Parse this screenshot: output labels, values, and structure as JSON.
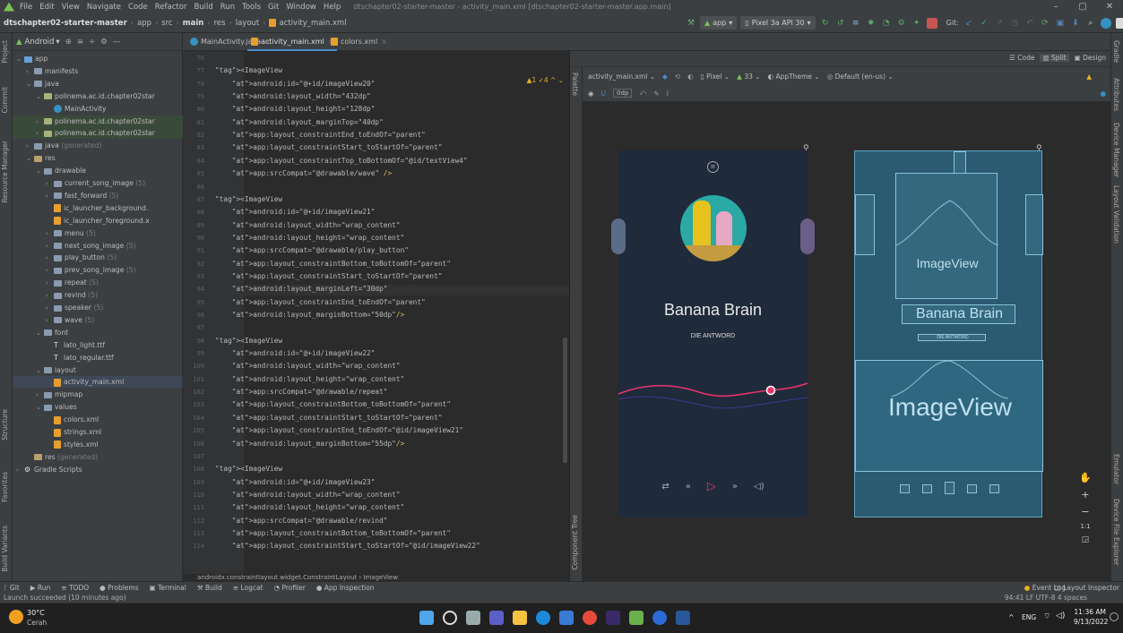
{
  "menubar": {
    "items": [
      "File",
      "Edit",
      "View",
      "Navigate",
      "Code",
      "Refactor",
      "Build",
      "Run",
      "Tools",
      "Git",
      "Window",
      "Help"
    ],
    "window_title": "dtschapter02-starter-master - activity_main.xml [dtschapter02-starter-master.app.main]",
    "controls": [
      "–",
      "▢",
      "✕"
    ]
  },
  "navbar": {
    "breadcrumbs": [
      "dtschapter02-starter-master",
      "app",
      "src",
      "main",
      "res",
      "layout",
      "activity_main.xml"
    ],
    "run_config": "app",
    "device": "Pixel 3a API 30",
    "git_label": "Git:"
  },
  "project_panel": {
    "view_label": "Android",
    "tree": [
      {
        "label": "app",
        "indent": 0,
        "kind": "module",
        "arrow": "⌄"
      },
      {
        "label": "manifests",
        "indent": 1,
        "kind": "folder",
        "arrow": "›"
      },
      {
        "label": "java",
        "indent": 1,
        "kind": "folder",
        "arrow": "⌄"
      },
      {
        "label": "polinema.ac.id.chapter02star",
        "indent": 2,
        "kind": "pkg",
        "arrow": "⌄"
      },
      {
        "label": "MainActivity",
        "indent": 3,
        "kind": "class",
        "arrow": ""
      },
      {
        "label": "polinema.ac.id.chapter02star",
        "indent": 2,
        "kind": "pkg",
        "arrow": "›",
        "extra": "sel2"
      },
      {
        "label": "polinema.ac.id.chapter02star",
        "indent": 2,
        "kind": "pkg",
        "arrow": "›",
        "extra": "sel2"
      },
      {
        "label": "java",
        "indent": 1,
        "kind": "folder",
        "arrow": "›",
        "suffix": " (generated)"
      },
      {
        "label": "res",
        "indent": 1,
        "kind": "res",
        "arrow": "⌄"
      },
      {
        "label": "drawable",
        "indent": 2,
        "kind": "folder",
        "arrow": "⌄"
      },
      {
        "label": "current_song_image",
        "indent": 3,
        "kind": "folder",
        "arrow": "›",
        "suffix": " (5)"
      },
      {
        "label": "fast_forward",
        "indent": 3,
        "kind": "folder",
        "arrow": "›",
        "suffix": " (5)"
      },
      {
        "label": "ic_launcher_background.",
        "indent": 3,
        "kind": "xml",
        "arrow": ""
      },
      {
        "label": "ic_launcher_foreground.x",
        "indent": 3,
        "kind": "xml",
        "arrow": ""
      },
      {
        "label": "menu",
        "indent": 3,
        "kind": "folder",
        "arrow": "›",
        "suffix": " (5)"
      },
      {
        "label": "next_song_image",
        "indent": 3,
        "kind": "folder",
        "arrow": "›",
        "suffix": " (5)"
      },
      {
        "label": "play_button",
        "indent": 3,
        "kind": "folder",
        "arrow": "›",
        "suffix": " (5)"
      },
      {
        "label": "prev_song_image",
        "indent": 3,
        "kind": "folder",
        "arrow": "›",
        "suffix": " (5)"
      },
      {
        "label": "repeat",
        "indent": 3,
        "kind": "folder",
        "arrow": "›",
        "suffix": " (5)"
      },
      {
        "label": "revind",
        "indent": 3,
        "kind": "folder",
        "arrow": "›",
        "suffix": " (5)"
      },
      {
        "label": "speaker",
        "indent": 3,
        "kind": "folder",
        "arrow": "›",
        "suffix": " (5)"
      },
      {
        "label": "wave",
        "indent": 3,
        "kind": "folder",
        "arrow": "›",
        "suffix": " (5)"
      },
      {
        "label": "font",
        "indent": 2,
        "kind": "folder",
        "arrow": "⌄"
      },
      {
        "label": "lato_light.ttf",
        "indent": 3,
        "kind": "ttf",
        "arrow": ""
      },
      {
        "label": "lato_regular.ttf",
        "indent": 3,
        "kind": "ttf",
        "arrow": ""
      },
      {
        "label": "layout",
        "indent": 2,
        "kind": "folder",
        "arrow": "⌄"
      },
      {
        "label": "activity_main.xml",
        "indent": 3,
        "kind": "xml",
        "arrow": ""
      },
      {
        "label": "mipmap",
        "indent": 2,
        "kind": "folder",
        "arrow": "›"
      },
      {
        "label": "values",
        "indent": 2,
        "kind": "folder",
        "arrow": "⌄"
      },
      {
        "label": "colors.xml",
        "indent": 3,
        "kind": "xml",
        "arrow": ""
      },
      {
        "label": "strings.xml",
        "indent": 3,
        "kind": "xml",
        "arrow": ""
      },
      {
        "label": "styles.xml",
        "indent": 3,
        "kind": "xml",
        "arrow": ""
      },
      {
        "label": "res",
        "indent": 1,
        "kind": "res",
        "arrow": "",
        "suffix": " (generated)"
      },
      {
        "label": "Gradle Scripts",
        "indent": 0,
        "kind": "gradle",
        "arrow": "›"
      }
    ]
  },
  "left_strip_labels": [
    "Project",
    "Commit",
    "Resource Manager",
    "Structure",
    "Favorites",
    "Build Variants"
  ],
  "right_strip_labels": [
    "Gradle",
    "Attributes",
    "Device Manager",
    "Layout Validation",
    "Emulator",
    "Device File Explorer"
  ],
  "tabs": [
    {
      "label": "MainActivity.java",
      "active": false
    },
    {
      "label": "activity_main.xml",
      "active": true
    },
    {
      "label": "colors.xml",
      "active": false
    }
  ],
  "editor": {
    "warning_indicator": "▲1 ✓4 ^ ⌄",
    "lines": [
      {
        "n": "76",
        "t": ""
      },
      {
        "n": "77",
        "t": "<ImageView"
      },
      {
        "n": "78",
        "t": "    android:id=\"@+id/imageView20\""
      },
      {
        "n": "79",
        "t": "    android:layout_width=\"432dp\""
      },
      {
        "n": "80",
        "t": "    android:layout_height=\"128dp\""
      },
      {
        "n": "81",
        "t": "    android:layout_marginTop=\"40dp\""
      },
      {
        "n": "82",
        "t": "    app:layout_constraintEnd_toEndOf=\"parent\""
      },
      {
        "n": "83",
        "t": "    app:layout_constraintStart_toStartOf=\"parent\""
      },
      {
        "n": "84",
        "t": "    app:layout_constraintTop_toBottomOf=\"@id/textView4\""
      },
      {
        "n": "85",
        "t": "    app:srcCompat=\"@drawable/wave\" />"
      },
      {
        "n": "86",
        "t": ""
      },
      {
        "n": "87",
        "t": "<ImageView"
      },
      {
        "n": "88",
        "t": "    android:id=\"@+id/imageView21\""
      },
      {
        "n": "89",
        "t": "    android:layout_width=\"wrap_content\""
      },
      {
        "n": "90",
        "t": "    android:layout_height=\"wrap_content\""
      },
      {
        "n": "91",
        "t": "    app:srcCompat=\"@drawable/play_button\""
      },
      {
        "n": "92",
        "t": "    app:layout_constraintBottom_toBottomOf=\"parent\""
      },
      {
        "n": "93",
        "t": "    app:layout_constraintStart_toStartOf=\"parent\""
      },
      {
        "n": "94",
        "t": "    android:layout_marginLeft=\"30dp\""
      },
      {
        "n": "95",
        "t": "    app:layout_constraintEnd_toEndOf=\"parent\""
      },
      {
        "n": "96",
        "t": "    android:layout_marginBottom=\"50dp\"/>"
      },
      {
        "n": "97",
        "t": ""
      },
      {
        "n": "98",
        "t": "<ImageView"
      },
      {
        "n": "99",
        "t": "    android:id=\"@+id/imageView22\""
      },
      {
        "n": "100",
        "t": "    android:layout_width=\"wrap_content\""
      },
      {
        "n": "101",
        "t": "    android:layout_height=\"wrap_content\""
      },
      {
        "n": "102",
        "t": "    app:srcCompat=\"@drawable/repeat\""
      },
      {
        "n": "103",
        "t": "    app:layout_constraintBottom_toBottomOf=\"parent\""
      },
      {
        "n": "104",
        "t": "    app:layout_constraintStart_toStartOf=\"parent\""
      },
      {
        "n": "105",
        "t": "    app:layout_constraintEnd_toEndOf=\"@id/imageView21\""
      },
      {
        "n": "106",
        "t": "    android:layout_marginBottom=\"55dp\"/>"
      },
      {
        "n": "107",
        "t": ""
      },
      {
        "n": "108",
        "t": "<ImageView"
      },
      {
        "n": "109",
        "t": "    android:id=\"@+id/imageView23\""
      },
      {
        "n": "110",
        "t": "    android:layout_width=\"wrap_content\""
      },
      {
        "n": "111",
        "t": "    android:layout_height=\"wrap_content\""
      },
      {
        "n": "112",
        "t": "    app:srcCompat=\"@drawable/revind\""
      },
      {
        "n": "113",
        "t": "    app:layout_constraintBottom_toBottomOf=\"parent\""
      },
      {
        "n": "114",
        "t": "    app:layout_constraintStart_toStartOf=\"@id/imageView22\""
      }
    ],
    "current_line": "94",
    "breadcrumb": "androidx.constraintlayout.widget.ConstraintLayout  ›  ImageView"
  },
  "design": {
    "mode_buttons": [
      "Code",
      "Split",
      "Design"
    ],
    "file_dropdown": "activity_main.xml ⌄",
    "device_dropdown": "Pixel ⌄",
    "api_dropdown": "33 ⌄",
    "theme_dropdown": "AppTheme ⌄",
    "locale_dropdown": "Default (en-us) ⌄",
    "margin_value": "0dp",
    "palette_label": "Palette",
    "component_tree_label": "Component Tree",
    "song_title": "Banana Brain",
    "artist": "DIE ANTWORD",
    "blueprint_imageview_small": "ImageView",
    "blueprint_imageview_large": "ImageView",
    "blueprint_title": "Banana Brain",
    "blueprint_artist": "DIE ANTWORD",
    "zoom_label": "1:1",
    "colors": {
      "phone_bg": "#1f2a3a",
      "wave_pink": "#e8336d",
      "wave_blue": "#4b3fb0",
      "accent": "#e8336d",
      "blueprint": "#2b5a73"
    }
  },
  "bottom_bar": {
    "items": [
      "Git",
      "Run",
      "TODO",
      "Problems",
      "Terminal",
      "Build",
      "Logcat",
      "Profiler",
      "App Inspection"
    ],
    "right": [
      "Event Log",
      "Layout Inspector"
    ]
  },
  "status": {
    "message": "Launch succeeded (10 minutes ago)",
    "right": "94:41  LF  UTF-8  4 spaces"
  },
  "taskbar": {
    "weather_temp": "30°C",
    "weather_desc": "Cerah",
    "lang": "ENG",
    "time": "11:36 AM",
    "date": "9/13/2022"
  }
}
